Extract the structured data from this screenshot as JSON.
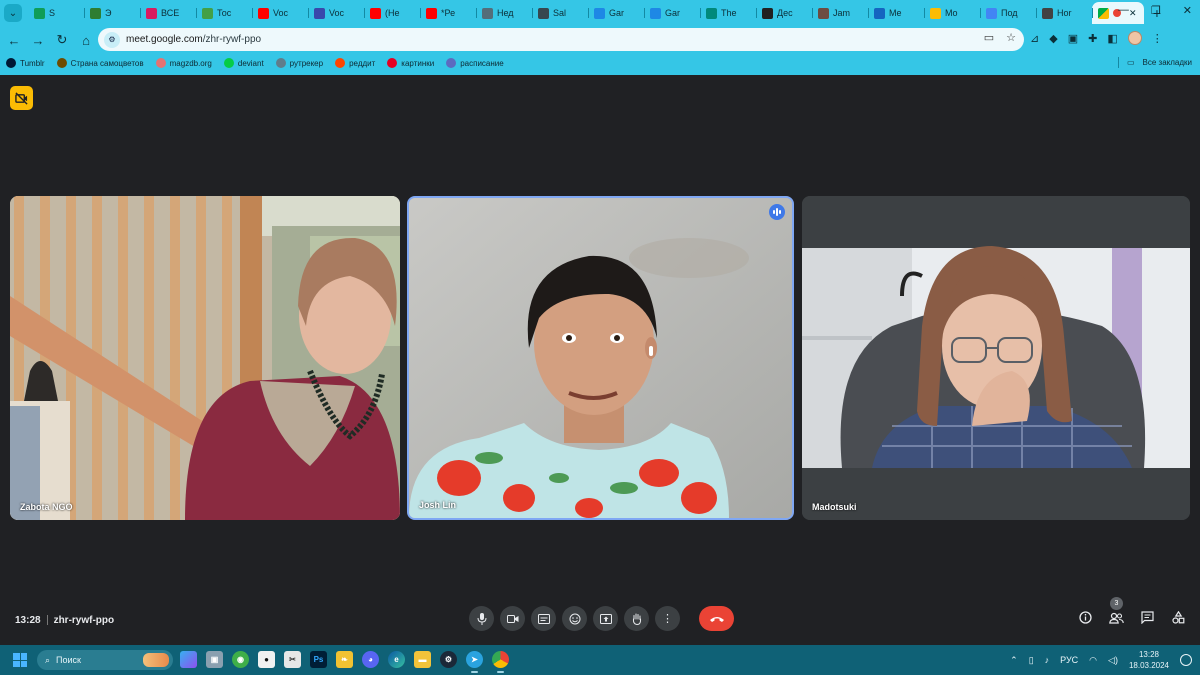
{
  "browser": {
    "tabs": [
      {
        "label": "S",
        "icon": "sheets-icon",
        "color": "#0f9d58"
      },
      {
        "label": "Э",
        "icon": "app-icon",
        "color": "#2e7d32"
      },
      {
        "label": "ВСЕ",
        "icon": "all-icon",
        "color": "#d81b60"
      },
      {
        "label": "Тос",
        "icon": "eye-icon",
        "color": "#43a047"
      },
      {
        "label": "Voc",
        "icon": "youtube-icon",
        "color": "#ff0000"
      },
      {
        "label": "Voc",
        "icon": "waveform-icon",
        "color": "#3949ab"
      },
      {
        "label": "(Не",
        "icon": "youtube-icon",
        "color": "#ff0000"
      },
      {
        "label": "*Ре",
        "icon": "youtube-icon",
        "color": "#ff0000"
      },
      {
        "label": "Нед",
        "icon": "m-icon",
        "color": "#546e7a"
      },
      {
        "label": "Sal",
        "icon": "photo-icon",
        "color": "#37474f"
      },
      {
        "label": "Gar",
        "icon": "globe-icon",
        "color": "#1e88e5"
      },
      {
        "label": "Gar",
        "icon": "globe-icon",
        "color": "#1e88e5"
      },
      {
        "label": "The",
        "icon": "globe-icon",
        "color": "#00897b"
      },
      {
        "label": "Дес",
        "icon": "k-icon",
        "color": "#212121"
      },
      {
        "label": "Jam",
        "icon": "jam-icon",
        "color": "#6d4c41"
      },
      {
        "label": "Me",
        "icon": "chat-icon",
        "color": "#1565c0"
      },
      {
        "label": "Mo",
        "icon": "drive-icon",
        "color": "#fbbc04"
      },
      {
        "label": "Под",
        "icon": "doc-icon",
        "color": "#4285f4"
      },
      {
        "label": "Hor",
        "icon": "globe-icon",
        "color": "#424242"
      }
    ],
    "active_tab_icon": "meet-icon",
    "url_host": "meet.google.com",
    "url_path": "/zhr-rywf-ppo",
    "bookmarks": [
      {
        "label": "Tumblr",
        "icon": "tumblr-icon",
        "color": "#001935"
      },
      {
        "label": "Страна самоцветов",
        "icon": "m-icon",
        "color": "#6d4c00"
      },
      {
        "label": "magzdb.org",
        "icon": "heart-icon",
        "color": "#e57373"
      },
      {
        "label": "deviant",
        "icon": "deviant-icon",
        "color": "#05cc47"
      },
      {
        "label": "рутрекер",
        "icon": "rutracker-icon",
        "color": "#607d8b"
      },
      {
        "label": "реддит",
        "icon": "reddit-icon",
        "color": "#ff4500"
      },
      {
        "label": "картинки",
        "icon": "pinterest-icon",
        "color": "#e60023"
      },
      {
        "label": "расписание",
        "icon": "schedule-icon",
        "color": "#5c6bc0"
      }
    ],
    "all_bookmarks": "Все закладки"
  },
  "meet": {
    "participants": [
      {
        "name": "Zabota NGO"
      },
      {
        "name": "Josh Lin"
      },
      {
        "name": "Madotsuki"
      }
    ],
    "time": "13:28",
    "meeting_code": "zhr-rywf-ppo",
    "people_count": "3"
  },
  "taskbar": {
    "search_label": "Поиск",
    "lang": "РУС",
    "time": "13:28",
    "date": "18.03.2024"
  }
}
